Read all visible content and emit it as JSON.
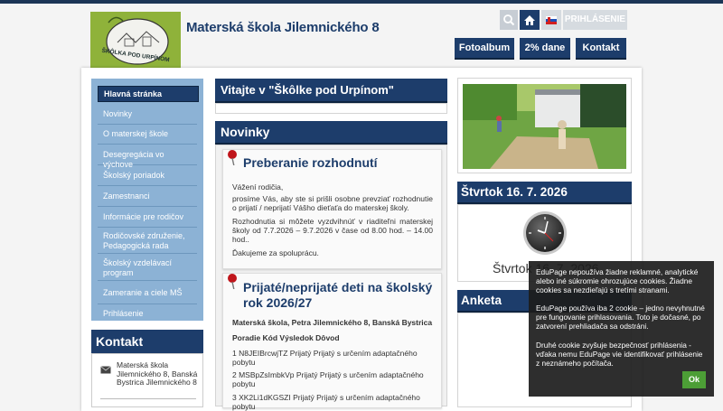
{
  "header": {
    "site_title": "Materská škola Jilemnického 8",
    "logo_text": "ŠKÔLKA POD URPÍNOM",
    "login_label": "PRIHLÁSENIE",
    "nav": [
      "Fotoalbum",
      "2% dane",
      "Kontakt"
    ]
  },
  "sidebar": {
    "items": [
      "Hlavná stránka",
      "Novinky",
      "O materskej škole",
      "Desegregácia vo výchove",
      "Školský poriadok",
      "Zamestnanci",
      "Informácie pre rodičov",
      "Rodičovské združenie, Pedagogická rada",
      "Školský vzdelávací program",
      "Zameranie a ciele MŠ",
      "Prihlásenie"
    ],
    "contact_title": "Kontakt",
    "contact_address": "Materská škola Jilemnického 8, Banská Bystrica Jilemnického 8"
  },
  "main": {
    "welcome_title": "Vitajte v \"Škôlke pod Urpínom\"",
    "news_title": "Novinky",
    "post1": {
      "title": "Preberanie rozhodnutí",
      "p1": "Vážení rodičia,",
      "p2": "prosíme Vás, aby ste si prišli osobne prevziať rozhodnutie o prijatí / neprijatí Vášho dieťaťa do materskej školy.",
      "p3": "Rozhodnutia si môžete vyzdvihnúť v riaditeľni materskej školy od 7.7.2026 – 9.7.2026 v čase od 8.00 hod. – 14.00 hod..",
      "p4": "Ďakujeme za spoluprácu."
    },
    "post2": {
      "title": "Prijaté/neprijaté deti na školský rok 2026/27",
      "school": "Materská škola, Petra Jilemnického 8, Banská Bystrica",
      "header_row": "Poradie Kód Výsledok Dôvod",
      "rows": [
        "1 N8JEIBrcwjTZ Prijatý Prijatý s určením adaptačného pobytu",
        "2 MSBpZsImbkVp Prijatý Prijatý s určením adaptačného pobytu",
        "3 XK2Li1dKGSZI Prijatý Prijatý s určením adaptačného pobytu"
      ]
    }
  },
  "right": {
    "date_title": "Štvrtok 16. 7. 2026",
    "date_caption": "Štvrtok 16. 7. 2026",
    "anketa_title": "Anketa"
  },
  "cookie": {
    "p1": "EduPage nepoužíva žiadne reklamné, analytické alebo iné súkromie ohrozujúce cookies. Žiadne cookies sa nezdieľajú s tretími stranami.",
    "p2": "EduPage používa iba 2 cookie – jedno nevyhnutné pre fungovanie prihlasovania. Toto je dočasné, po zatvorení prehliadača sa odstráni.",
    "p3": "Druhé cookie zvyšuje bezpečnosť prihlásenia - vďaka nemu EduPage vie identifikovať prihlásenie z neznámeho počítača.",
    "ok_label": "Ok"
  }
}
